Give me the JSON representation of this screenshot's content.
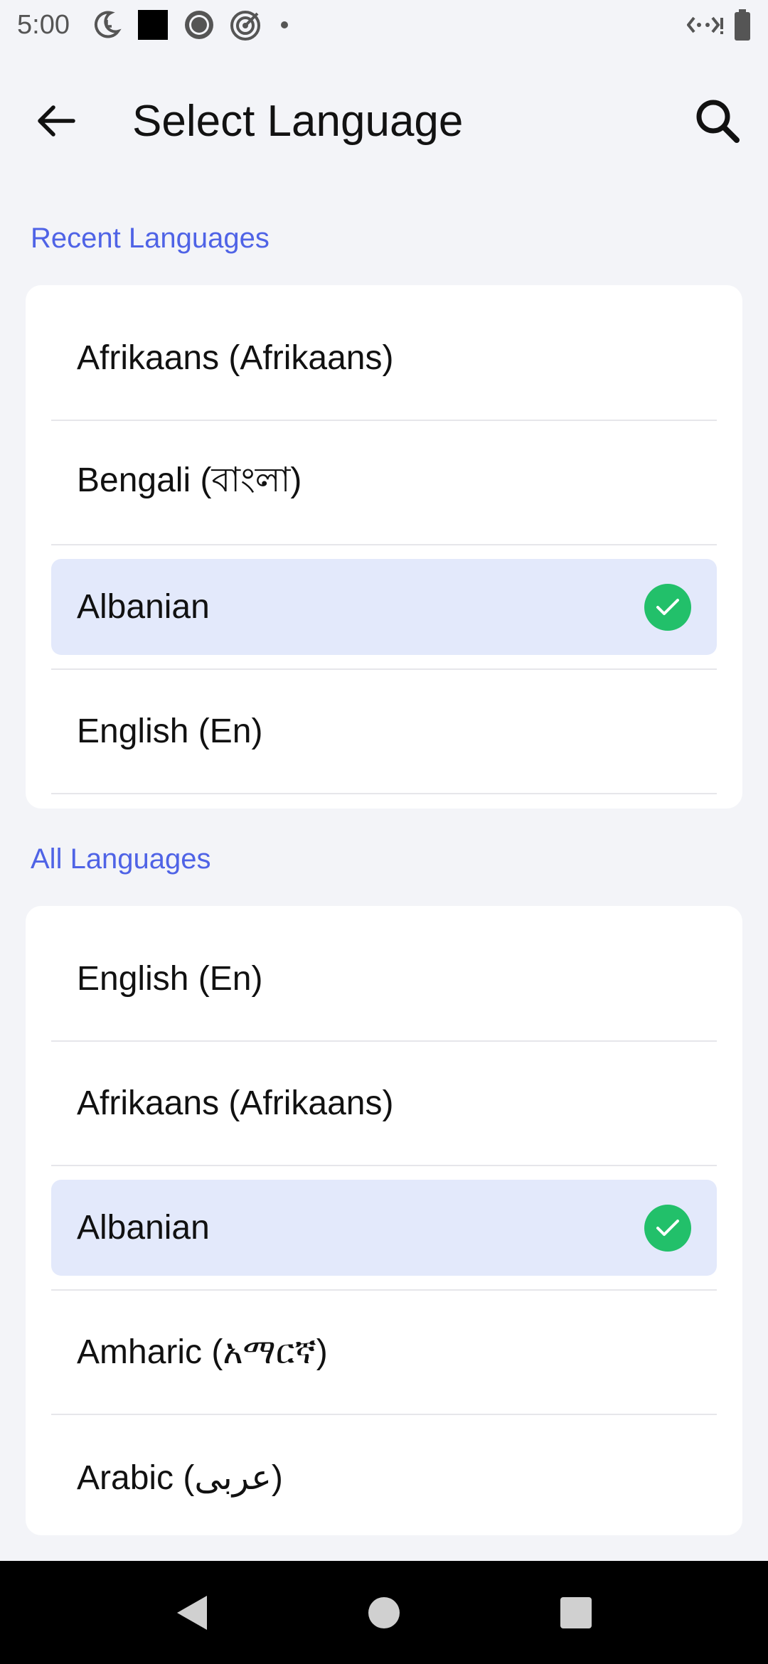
{
  "status_bar": {
    "time": "5:00",
    "icons": [
      "moon-clock-icon",
      "black-square-icon",
      "record-icon",
      "target-icon",
      "dot-icon"
    ],
    "right_icons": [
      "code-signal-icon",
      "battery-icon"
    ]
  },
  "app_bar": {
    "title": "Select Language",
    "back_icon": "arrow-left-icon",
    "search_icon": "search-icon"
  },
  "recent": {
    "heading": "Recent Languages",
    "items": [
      {
        "label": "Afrikaans (Afrikaans)",
        "selected": false
      },
      {
        "label": "Bengali (বাংলা)",
        "selected": false
      },
      {
        "label": "Albanian",
        "selected": true
      },
      {
        "label": "English (En)",
        "selected": false
      }
    ]
  },
  "all": {
    "heading": "All Languages",
    "items": [
      {
        "label": "English (En)",
        "selected": false
      },
      {
        "label": "Afrikaans (Afrikaans)",
        "selected": false
      },
      {
        "label": "Albanian",
        "selected": true
      },
      {
        "label": "Amharic (አማርኛ)",
        "selected": false
      },
      {
        "label": "Arabic (عربى)",
        "selected": false
      }
    ]
  },
  "colors": {
    "accent": "#4f63e6",
    "selected_bg": "#e3e9fb",
    "check": "#22c06a",
    "background": "#f3f4f8"
  },
  "nav_bar": {
    "icons": [
      "back-triangle-icon",
      "home-circle-icon",
      "recents-square-icon"
    ]
  }
}
